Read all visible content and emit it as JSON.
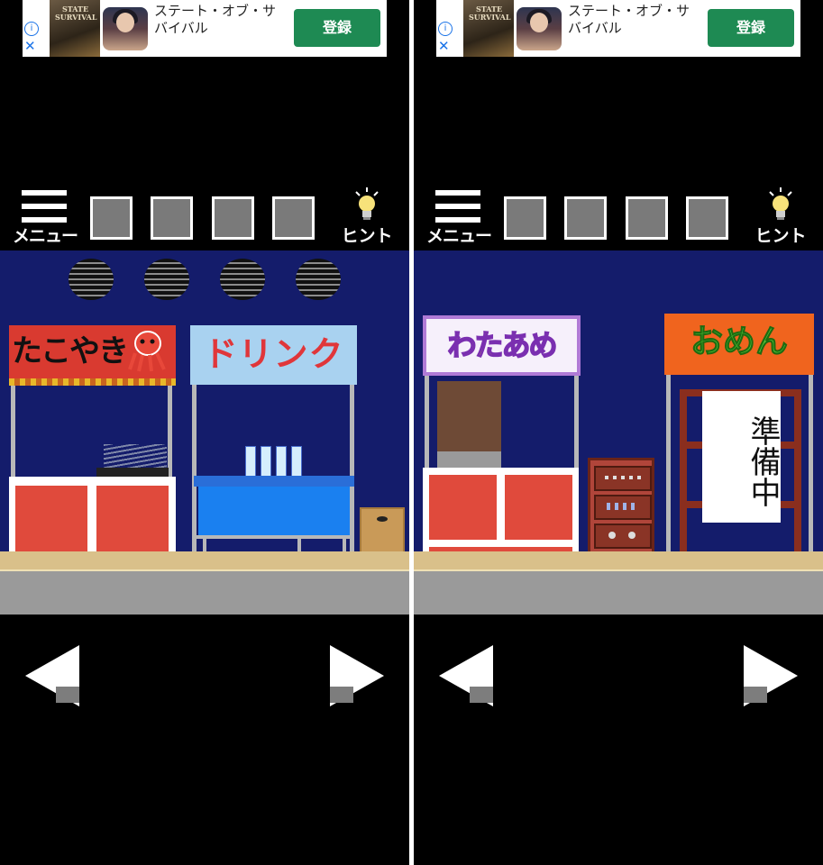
{
  "ad": {
    "game_logo_text": "STATE SURVIVAL",
    "title": "ステート・オブ・サバイバル",
    "install_button": "登録",
    "info_icon": "info-icon",
    "close_icon": "close-icon"
  },
  "toolbar": {
    "menu_label": "メニュー",
    "hint_label": "ヒント",
    "inventory_slots": 4
  },
  "left_scene": {
    "takoyaki_sign": "たこやき",
    "drink_sign": "ドリンク"
  },
  "right_scene": {
    "wataame_sign": "わたあめ",
    "omen_sign": "おめん",
    "preparing_sign": "準備中"
  },
  "colors": {
    "sky": "#141c6b",
    "stall_red": "#e04a3c",
    "install_green": "#1e8a53"
  }
}
